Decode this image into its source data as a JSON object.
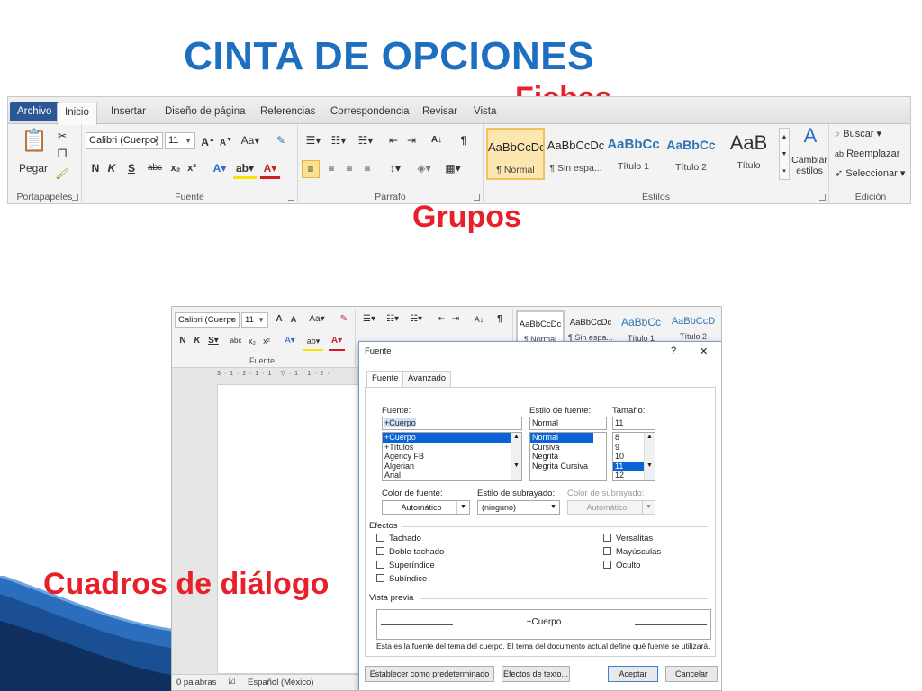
{
  "slide": {
    "title": "CINTA DE OPCIONES",
    "callouts": {
      "fichas": "Fichas",
      "grupos": "Grupos",
      "cuadros": "Cuadros de diálogo"
    }
  },
  "ribbon": {
    "tabs": [
      "Archivo",
      "Inicio",
      "Insertar",
      "Diseño de página",
      "Referencias",
      "Correspondencia",
      "Revisar",
      "Vista"
    ],
    "active_tab": "Inicio",
    "groups": {
      "portapapeles": {
        "name": "Portapapeles",
        "paste_label": "Pegar"
      },
      "fuente": {
        "name": "Fuente",
        "font": "Calibri (Cuerpo)",
        "size": "11",
        "bold": "N",
        "italic": "K",
        "underline": "S",
        "strike": "abc"
      },
      "parrafo": {
        "name": "Párrafo"
      },
      "estilos": {
        "name": "Estilos",
        "items": [
          {
            "sample": "AaBbCcDc",
            "label": "¶ Normal"
          },
          {
            "sample": "AaBbCcDc",
            "label": "¶ Sin espa..."
          },
          {
            "sample": "AaBbCc",
            "label": "Título 1"
          },
          {
            "sample": "AaBbCc",
            "label": "Título 2"
          },
          {
            "sample": "AaB",
            "label": "Título"
          }
        ],
        "change_label": "Cambiar estilos"
      },
      "edicion": {
        "name": "Edición",
        "buscar": "Buscar",
        "reemplazar": "Reemplazar",
        "seleccionar": "Seleccionar"
      }
    }
  },
  "word2": {
    "font": "Calibri (Cuerpo",
    "size": "11",
    "group_fuente": "Fuente",
    "styles": [
      {
        "sample": "AaBbCcDc",
        "label": "¶ Normal"
      },
      {
        "sample": "AaBbCcDc",
        "label": "¶ Sin espa..."
      },
      {
        "sample": "AaBbCc",
        "label": "Título 1"
      },
      {
        "sample": "AaBbCcD",
        "label": "Título 2"
      }
    ],
    "status": {
      "words": "0 palabras",
      "language": "Español (México)"
    }
  },
  "dialog": {
    "title": "Fuente",
    "help": "?",
    "close": "✕",
    "tabs": [
      "Fuente",
      "Avanzado"
    ],
    "font_label": "Fuente:",
    "font_value": "+Cuerpo",
    "font_list": [
      "+Cuerpo",
      "+Títulos",
      "Agency FB",
      "Algerian",
      "Arial"
    ],
    "style_label": "Estilo de fuente:",
    "style_value": "Normal",
    "style_list": [
      "Normal",
      "Cursiva",
      "Negrita",
      "Negrita Cursiva"
    ],
    "size_label": "Tamaño:",
    "size_value": "11",
    "size_list": [
      "8",
      "9",
      "10",
      "11",
      "12"
    ],
    "color_label": "Color de fuente:",
    "color_value": "Automático",
    "underline_label": "Estilo de subrayado:",
    "underline_value": "(ninguno)",
    "underline_color_label": "Color de subrayado:",
    "underline_color_value": "Automático",
    "effects_label": "Efectos",
    "effects_left": [
      "Tachado",
      "Doble tachado",
      "Superíndice",
      "Subíndice"
    ],
    "effects_right": [
      "Versalitas",
      "Mayúsculas",
      "Oculto"
    ],
    "preview_label": "Vista previa",
    "preview_text": "+Cuerpo",
    "description": "Esta es la fuente del tema del cuerpo. El tema del documento actual define qué fuente se utilizará.",
    "buttons": {
      "default": "Establecer como predeterminado",
      "effects": "Efectos de texto...",
      "ok": "Aceptar",
      "cancel": "Cancelar"
    }
  }
}
